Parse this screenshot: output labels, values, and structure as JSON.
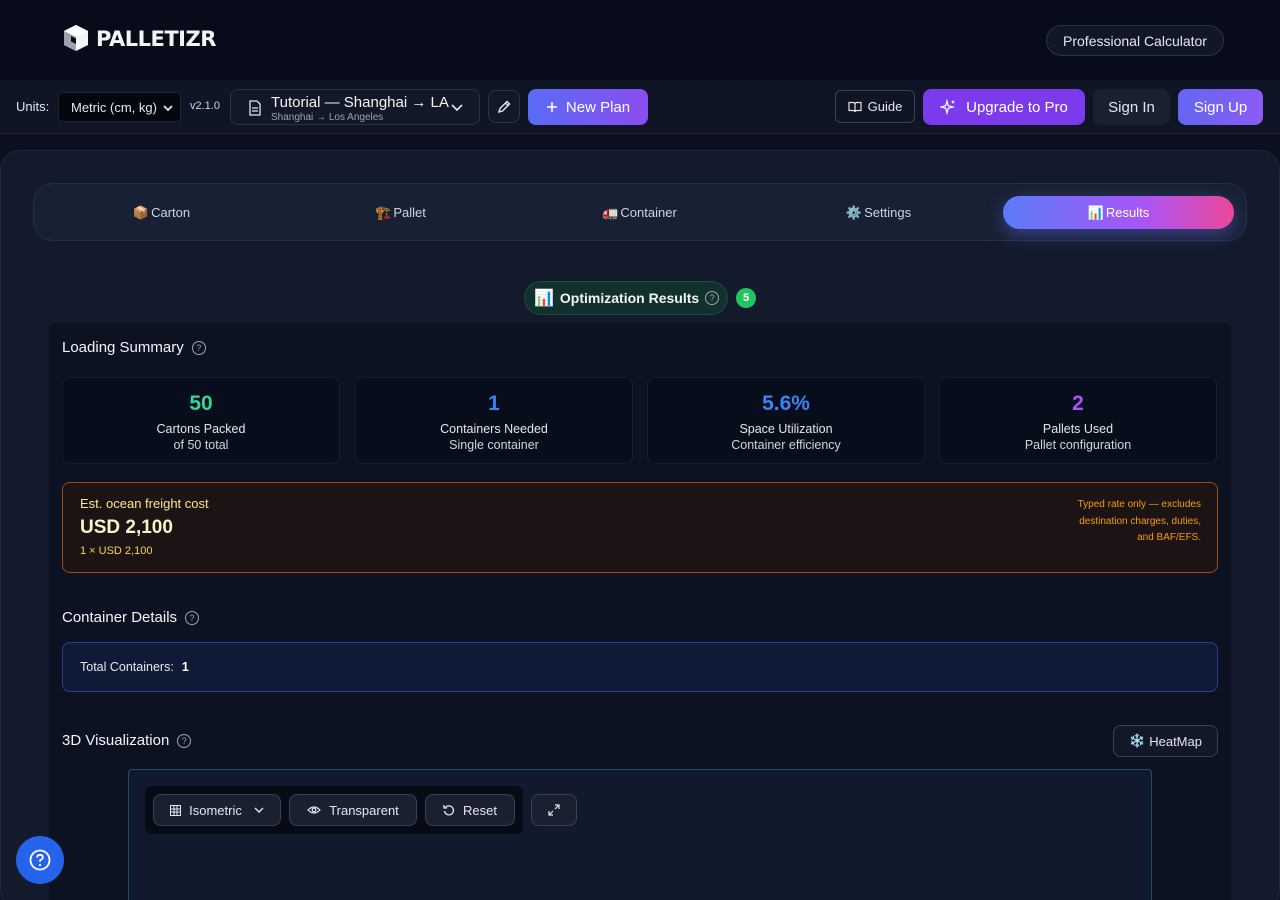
{
  "brand": {
    "name": "PALLETIZR"
  },
  "header": {
    "pro_calculator": "Professional Calculator"
  },
  "toolbar": {
    "units_label": "Units:",
    "units_value": "Metric (cm, kg)",
    "version": "v2.1.0",
    "plan_title": "Tutorial — Shanghai → LA",
    "plan_subtitle": "Shanghai → Los Angeles",
    "new_plan": "New Plan",
    "guide": "Guide",
    "upgrade": "Upgrade to Pro",
    "sign_in": "Sign In",
    "sign_up": "Sign Up"
  },
  "tabs": [
    {
      "icon": "📦",
      "label": "Carton"
    },
    {
      "icon": "🏗️",
      "label": "Pallet"
    },
    {
      "icon": "🚛",
      "label": "Container"
    },
    {
      "icon": "⚙️",
      "label": "Settings"
    },
    {
      "icon": "📊",
      "label": "Results",
      "active": true
    }
  ],
  "results": {
    "icon": "📊",
    "title": "Optimization Results",
    "count": "5"
  },
  "loading_summary": {
    "title": "Loading Summary",
    "stats": [
      {
        "value": "50",
        "label": "Cartons Packed",
        "sub": "of 50 total",
        "color": "#34d399"
      },
      {
        "value": "1",
        "label": "Containers Needed",
        "sub": "Single container",
        "color": "#3b82f6"
      },
      {
        "value": "5.6%",
        "label": "Space Utilization",
        "sub": "Container efficiency",
        "color": "#3b82f6"
      },
      {
        "value": "2",
        "label": "Pallets Used",
        "sub": "Pallet configuration",
        "color": "#a855f7"
      }
    ]
  },
  "freight": {
    "label": "Est. ocean freight cost",
    "value": "USD 2,100",
    "detail": "1 × USD 2,100",
    "note": "Typed rate only — excludes destination charges, duties, and BAF/EFS."
  },
  "container_details": {
    "title": "Container Details",
    "total_label": "Total Containers:",
    "total_value": "1"
  },
  "visualization": {
    "title": "3D Visualization",
    "heatmap_icon": "❄️",
    "heatmap": "HeatMap",
    "view_mode": "Isometric",
    "transparent": "Transparent",
    "reset": "Reset"
  },
  "colors": {
    "accent": "#6366f1",
    "upgrade": "#7c3aed",
    "success": "#22c55e",
    "help": "#2563eb"
  }
}
